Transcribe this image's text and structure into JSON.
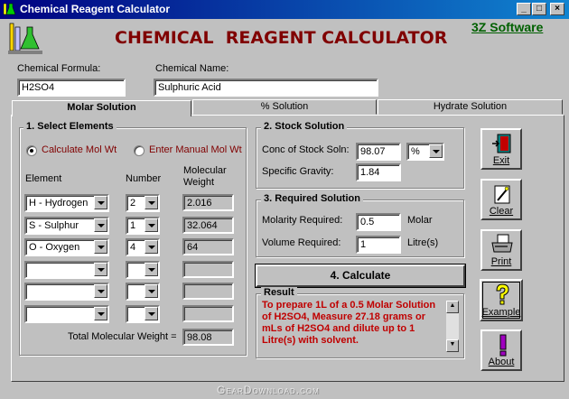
{
  "window": {
    "title": "Chemical Reagent Calculator",
    "min": "_",
    "max": "□",
    "close": "×"
  },
  "header": {
    "title": "CHEMICAL  REAGENT CALCULATOR",
    "vendor": "3Z Software"
  },
  "formula": {
    "label": "Chemical Formula:",
    "value": "H2SO4"
  },
  "name": {
    "label": "Chemical Name:",
    "value": "Sulphuric Acid"
  },
  "tabs": [
    "Molar Solution",
    "% Solution",
    "Hydrate Solution"
  ],
  "select": {
    "title": "1. Select Elements",
    "radio_calc": "Calculate Mol Wt",
    "radio_manual": "Enter Manual Mol Wt",
    "col_element": "Element",
    "col_number": "Number",
    "col_molwt": "Molecular Weight",
    "rows": [
      {
        "element": "H  - Hydrogen",
        "number": "2",
        "weight": "2.016"
      },
      {
        "element": "S  - Sulphur",
        "number": "1",
        "weight": "32.064"
      },
      {
        "element": "O  - Oxygen",
        "number": "4",
        "weight": "64"
      },
      {
        "element": "",
        "number": "",
        "weight": ""
      },
      {
        "element": "",
        "number": "",
        "weight": ""
      },
      {
        "element": "",
        "number": "",
        "weight": ""
      }
    ],
    "total_label": "Total Molecular Weight =",
    "total_value": "98.08"
  },
  "stock": {
    "title": "2. Stock Solution",
    "conc_label": "Conc of Stock Soln:",
    "conc_value": "98.07",
    "conc_unit": "%",
    "sg_label": "Specific Gravity:",
    "sg_value": "1.84"
  },
  "required": {
    "title": "3. Required Solution",
    "molarity_label": "Molarity Required:",
    "molarity_value": "0.5",
    "molarity_unit": "Molar",
    "volume_label": "Volume Required:",
    "volume_value": "1",
    "volume_unit": "Litre(s)"
  },
  "calculate_label": "4. Calculate",
  "result": {
    "title": "Result",
    "text": "To prepare 1L of a 0.5 Molar Solution of H2SO4, Measure 27.18 grams or mLs of H2SO4 and dilute up to 1 Litre(s) with solvent."
  },
  "side_buttons": {
    "exit": "Exit",
    "clear": "Clear",
    "print": "Print",
    "example": "Example",
    "about": "About"
  },
  "watermark": "GearDownload.com",
  "colors": {
    "title_red": "#800000",
    "vendor_green": "#006000",
    "result_red": "#c00000"
  }
}
